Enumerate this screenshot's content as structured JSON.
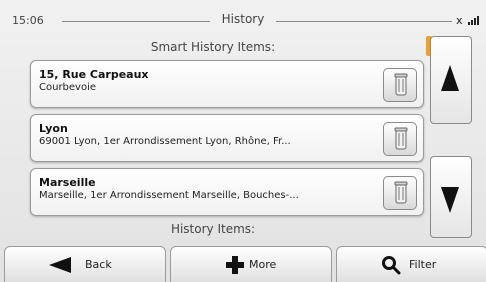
{
  "status": {
    "time": "15:06",
    "title": "History"
  },
  "sections": {
    "smart": "Smart History Items:",
    "history": "History Items:"
  },
  "items": [
    {
      "title": "15, Rue Carpeaux",
      "subtitle": "Courbevoie"
    },
    {
      "title": "Lyon",
      "subtitle": "69001 Lyon, 1er Arrondissement Lyon, Rhône, Fr..."
    },
    {
      "title": "Marseille",
      "subtitle": "Marseille, 1er Arrondissement Marseille, Bouches-..."
    }
  ],
  "buttons": {
    "back": "Back",
    "more": "More",
    "filter": "Filter"
  },
  "colors": {
    "accent": "#f2a125"
  }
}
